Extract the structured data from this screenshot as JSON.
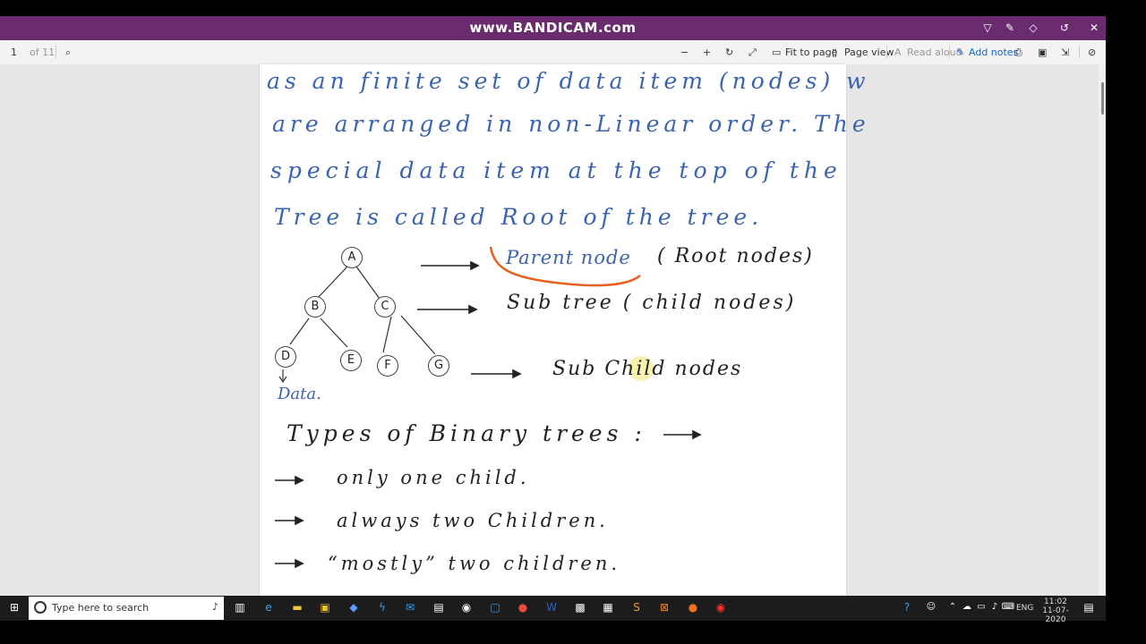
{
  "watermark": {
    "text": "www.BANDICAM.com"
  },
  "window_controls": {
    "close_icon": "close-icon"
  },
  "toolbar": {
    "page_number": "1",
    "page_total": "of 11",
    "fit_label": "Fit to page",
    "page_view_label": "Page view",
    "read_aloud_label": "Read aloud",
    "add_notes_label": "Add notes"
  },
  "document": {
    "lines": [
      "as an finite set of data item (nodes) w",
      "are arranged in non-Linear order. The",
      "special data item at the top of the",
      "Tree is called Root of the tree."
    ],
    "nodes": [
      "A",
      "B",
      "C",
      "D",
      "E",
      "F",
      "G"
    ],
    "labels": {
      "parent": "Parent node",
      "parent_note": "( Root nodes)",
      "subtree": "Sub tree ( child nodes)",
      "subchild": "Sub Child nodes",
      "data": "Data."
    },
    "types_title": "Types of Binary trees :",
    "types": [
      "only one child.",
      "always two Children.",
      "“mostly” two children."
    ]
  },
  "taskbar": {
    "search_placeholder": "Type here to search",
    "lang": "ENG",
    "time": "11:02",
    "date": "11-07-2020"
  },
  "colors": {
    "titlebar": "#6b2b6f",
    "annotation": "#e5621f",
    "ink_blue": "#3a63b0"
  }
}
